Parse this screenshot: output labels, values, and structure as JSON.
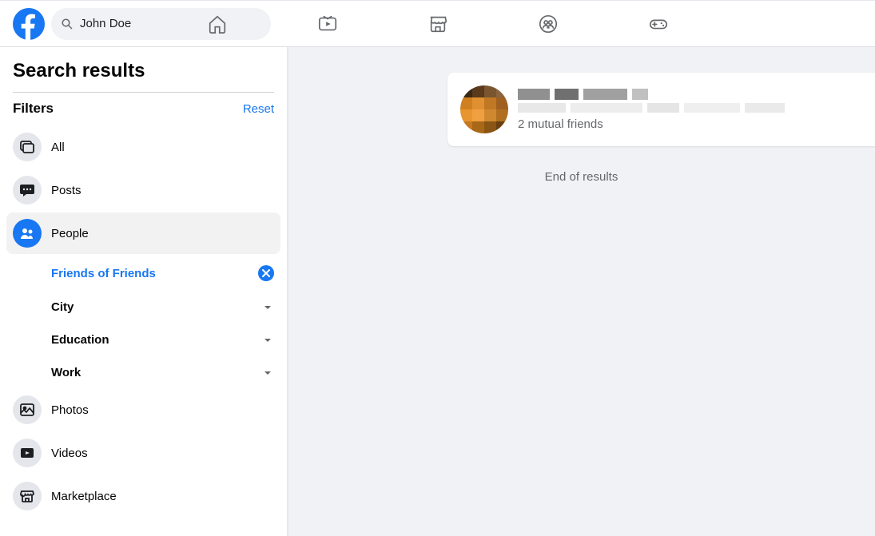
{
  "header": {
    "search_value": "John Doe"
  },
  "sidebar": {
    "title": "Search results",
    "filters_label": "Filters",
    "reset_label": "Reset",
    "items": [
      {
        "label": "All"
      },
      {
        "label": "Posts"
      },
      {
        "label": "People"
      },
      {
        "label": "Photos"
      },
      {
        "label": "Videos"
      },
      {
        "label": "Marketplace"
      }
    ],
    "sub_filters": [
      {
        "label": "Friends of Friends"
      },
      {
        "label": "City"
      },
      {
        "label": "Education"
      },
      {
        "label": "Work"
      }
    ]
  },
  "results": {
    "mutual_text": "2 mutual friends",
    "end_text": "End of results"
  }
}
